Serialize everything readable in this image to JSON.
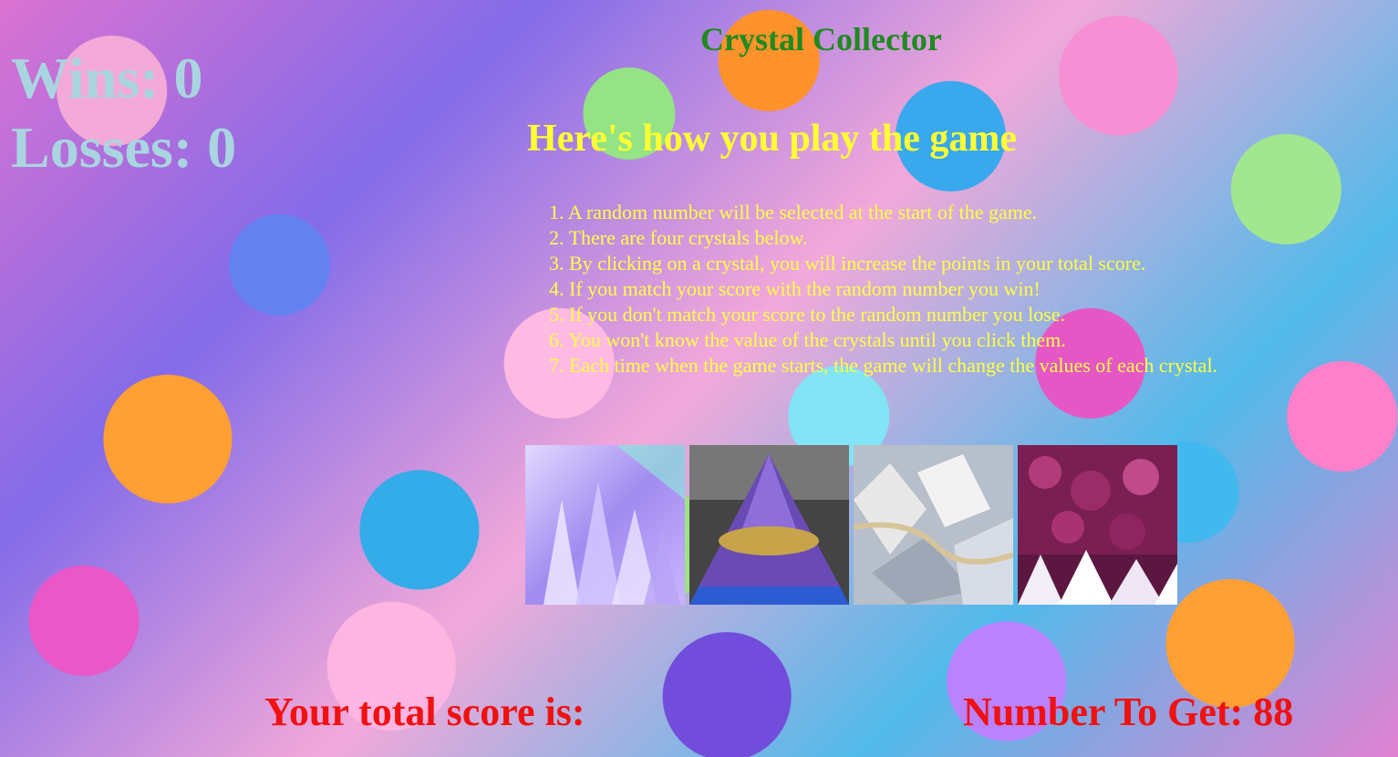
{
  "header": {
    "title": "Crystal Collector"
  },
  "stats": {
    "wins_label": "Wins: 0",
    "losses_label": "Losses: 0"
  },
  "instructions": {
    "title": "Here's how you play the game",
    "rules": [
      "1. A random number will be selected at the start of the game.",
      "2. There are four crystals below.",
      "3. By clicking on a crystal, you will increase the points in your total score.",
      "4. If you match your score with the random number you win!",
      "5. If you don't match your score to the random number you lose.",
      "6. You won't know the value of the crystals until you click them.",
      "7. Each time when the game starts, the game will change the values of each crystal."
    ]
  },
  "crystals": [
    {
      "name": "crystal-1",
      "colors": [
        "#c9b5ff",
        "#8c79e8",
        "#e3d8ff"
      ]
    },
    {
      "name": "crystal-2",
      "colors": [
        "#6a4bb5",
        "#c7a34a",
        "#2d5bd1"
      ]
    },
    {
      "name": "crystal-3",
      "colors": [
        "#e6e6e6",
        "#9ea7b5",
        "#d8c49b"
      ]
    },
    {
      "name": "crystal-4",
      "colors": [
        "#7a1f52",
        "#b23b7a",
        "#f4eef8"
      ]
    }
  ],
  "footer": {
    "score_label": "Your total score is:",
    "target_label": "Number To Get: 88"
  },
  "colors": {
    "title": "#1f8a1f",
    "stats": "#a9d5e0",
    "instructions": "#ffff33",
    "score": "#f01111"
  }
}
